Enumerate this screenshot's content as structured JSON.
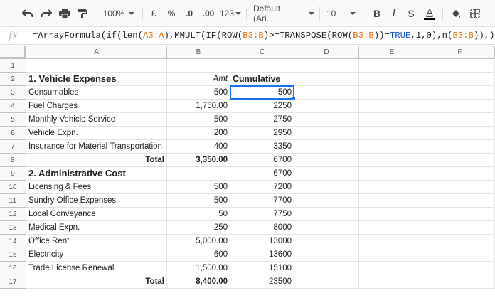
{
  "toolbar": {
    "zoom": "100%",
    "currency": "£",
    "percent": "%",
    "decrease_decimal": ".0",
    "increase_decimal": ".00",
    "more_formats": "123",
    "font": "Default (Ari...",
    "font_size": "10",
    "bold": "B",
    "italic": "I",
    "strike": "S",
    "text_color": "A"
  },
  "formula_bar": {
    "fx": "fx",
    "part1": "=ArrayFormula(if(len(",
    "ref1": "A3:A",
    "part2": "),MMULT(IF(ROW(",
    "ref2": "B3:B",
    "part3": ")>=TRANSPOSE(ROW(",
    "ref3": "B3:B",
    "part4": "))=",
    "true": "TRUE",
    "part5": ",1,0),n(",
    "ref4": "B3:B",
    "part6": ")),))"
  },
  "columns": [
    "A",
    "B",
    "C",
    "D",
    "E",
    "F"
  ],
  "rows": [
    {
      "n": "1",
      "a": "",
      "b": "",
      "c": ""
    },
    {
      "n": "2",
      "a": "1. Vehicle Expenses",
      "b": "Amt",
      "c": "Cumulative"
    },
    {
      "n": "3",
      "a": "Consumables",
      "b": "500",
      "c": "500"
    },
    {
      "n": "4",
      "a": "Fuel Charges",
      "b": "1,750.00",
      "c": "2250"
    },
    {
      "n": "5",
      "a": "Monthly Vehicle Service",
      "b": "500",
      "c": "2750"
    },
    {
      "n": "6",
      "a": "Vehicle Expn.",
      "b": "200",
      "c": "2950"
    },
    {
      "n": "7",
      "a": "Insurance for Material Transportation",
      "b": "400",
      "c": "3350"
    },
    {
      "n": "8",
      "a": "Total",
      "b": "3,350.00",
      "c": "6700"
    },
    {
      "n": "9",
      "a": "2. Administrative Cost",
      "b": "",
      "c": "6700"
    },
    {
      "n": "10",
      "a": "Licensing & Fees",
      "b": "500",
      "c": "7200"
    },
    {
      "n": "11",
      "a": "Sundry Office Expenses",
      "b": "500",
      "c": "7700"
    },
    {
      "n": "12",
      "a": "Local Conveyance",
      "b": "50",
      "c": "7750"
    },
    {
      "n": "13",
      "a": "Medical Expn.",
      "b": "250",
      "c": "8000"
    },
    {
      "n": "14",
      "a": "Office Rent",
      "b": "5,000.00",
      "c": "13000"
    },
    {
      "n": "15",
      "a": "Electricity",
      "b": "600",
      "c": "13600"
    },
    {
      "n": "16",
      "a": "Trade License Renewal",
      "b": "1,500.00",
      "c": "15100"
    },
    {
      "n": "17",
      "a": "Total",
      "b": "8,400.00",
      "c": "23500"
    }
  ]
}
